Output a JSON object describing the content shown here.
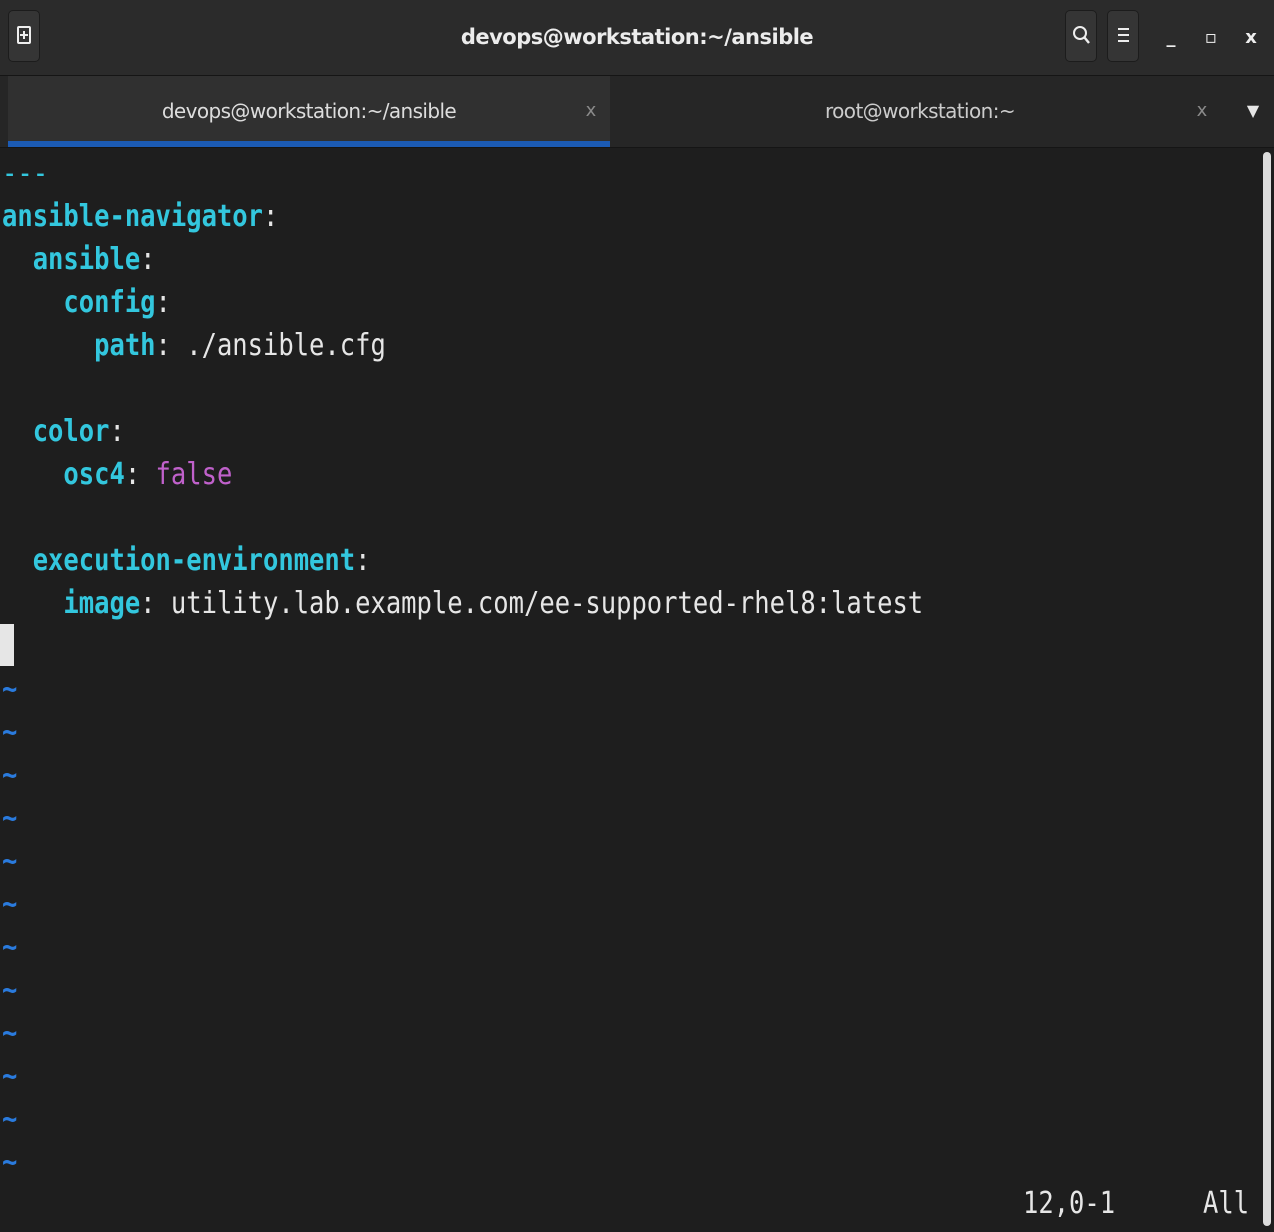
{
  "window": {
    "title": "devops@workstation:~/ansible"
  },
  "headerbar": {
    "new_tab_icon": "new-tab-icon",
    "search_icon": "search-icon",
    "menu_icon": "hamburger-menu-icon",
    "minimize_glyph": "_",
    "maximize_glyph": "▫",
    "close_glyph": "x"
  },
  "tabs": [
    {
      "label": "devops@workstation:~/ansible",
      "close": "x",
      "active": true
    },
    {
      "label": "root@workstation:~",
      "close": "x",
      "active": false
    }
  ],
  "tab_dropdown_glyph": "▼",
  "editor": {
    "lines": [
      {
        "doc": "---"
      },
      {
        "indent": "",
        "key": "ansible-navigator",
        "sep": ":"
      },
      {
        "indent": "  ",
        "key": "ansible",
        "sep": ":"
      },
      {
        "indent": "    ",
        "key": "config",
        "sep": ":"
      },
      {
        "indent": "      ",
        "key": "path",
        "sep": ": ",
        "value": "./ansible.cfg"
      },
      {
        "indent": "  ",
        "key": "color",
        "sep": ":"
      },
      {
        "indent": "    ",
        "key": "osc4",
        "sep": ": ",
        "bool": "false"
      },
      {
        "indent": "  ",
        "key": "execution-environment",
        "sep": ":"
      },
      {
        "indent": "    ",
        "key": "image",
        "sep": ": ",
        "value": "utility.lab.example.com/ee-supported-rhel8:latest"
      }
    ],
    "tilde": "~",
    "status_position": "12,0-1",
    "status_scroll": "All"
  },
  "colors": {
    "key": "#33c7de",
    "boolean": "#c061cb",
    "tilde": "#2a7bde",
    "tab_underline": "#1c5bb4",
    "background": "#1e1e1e"
  }
}
